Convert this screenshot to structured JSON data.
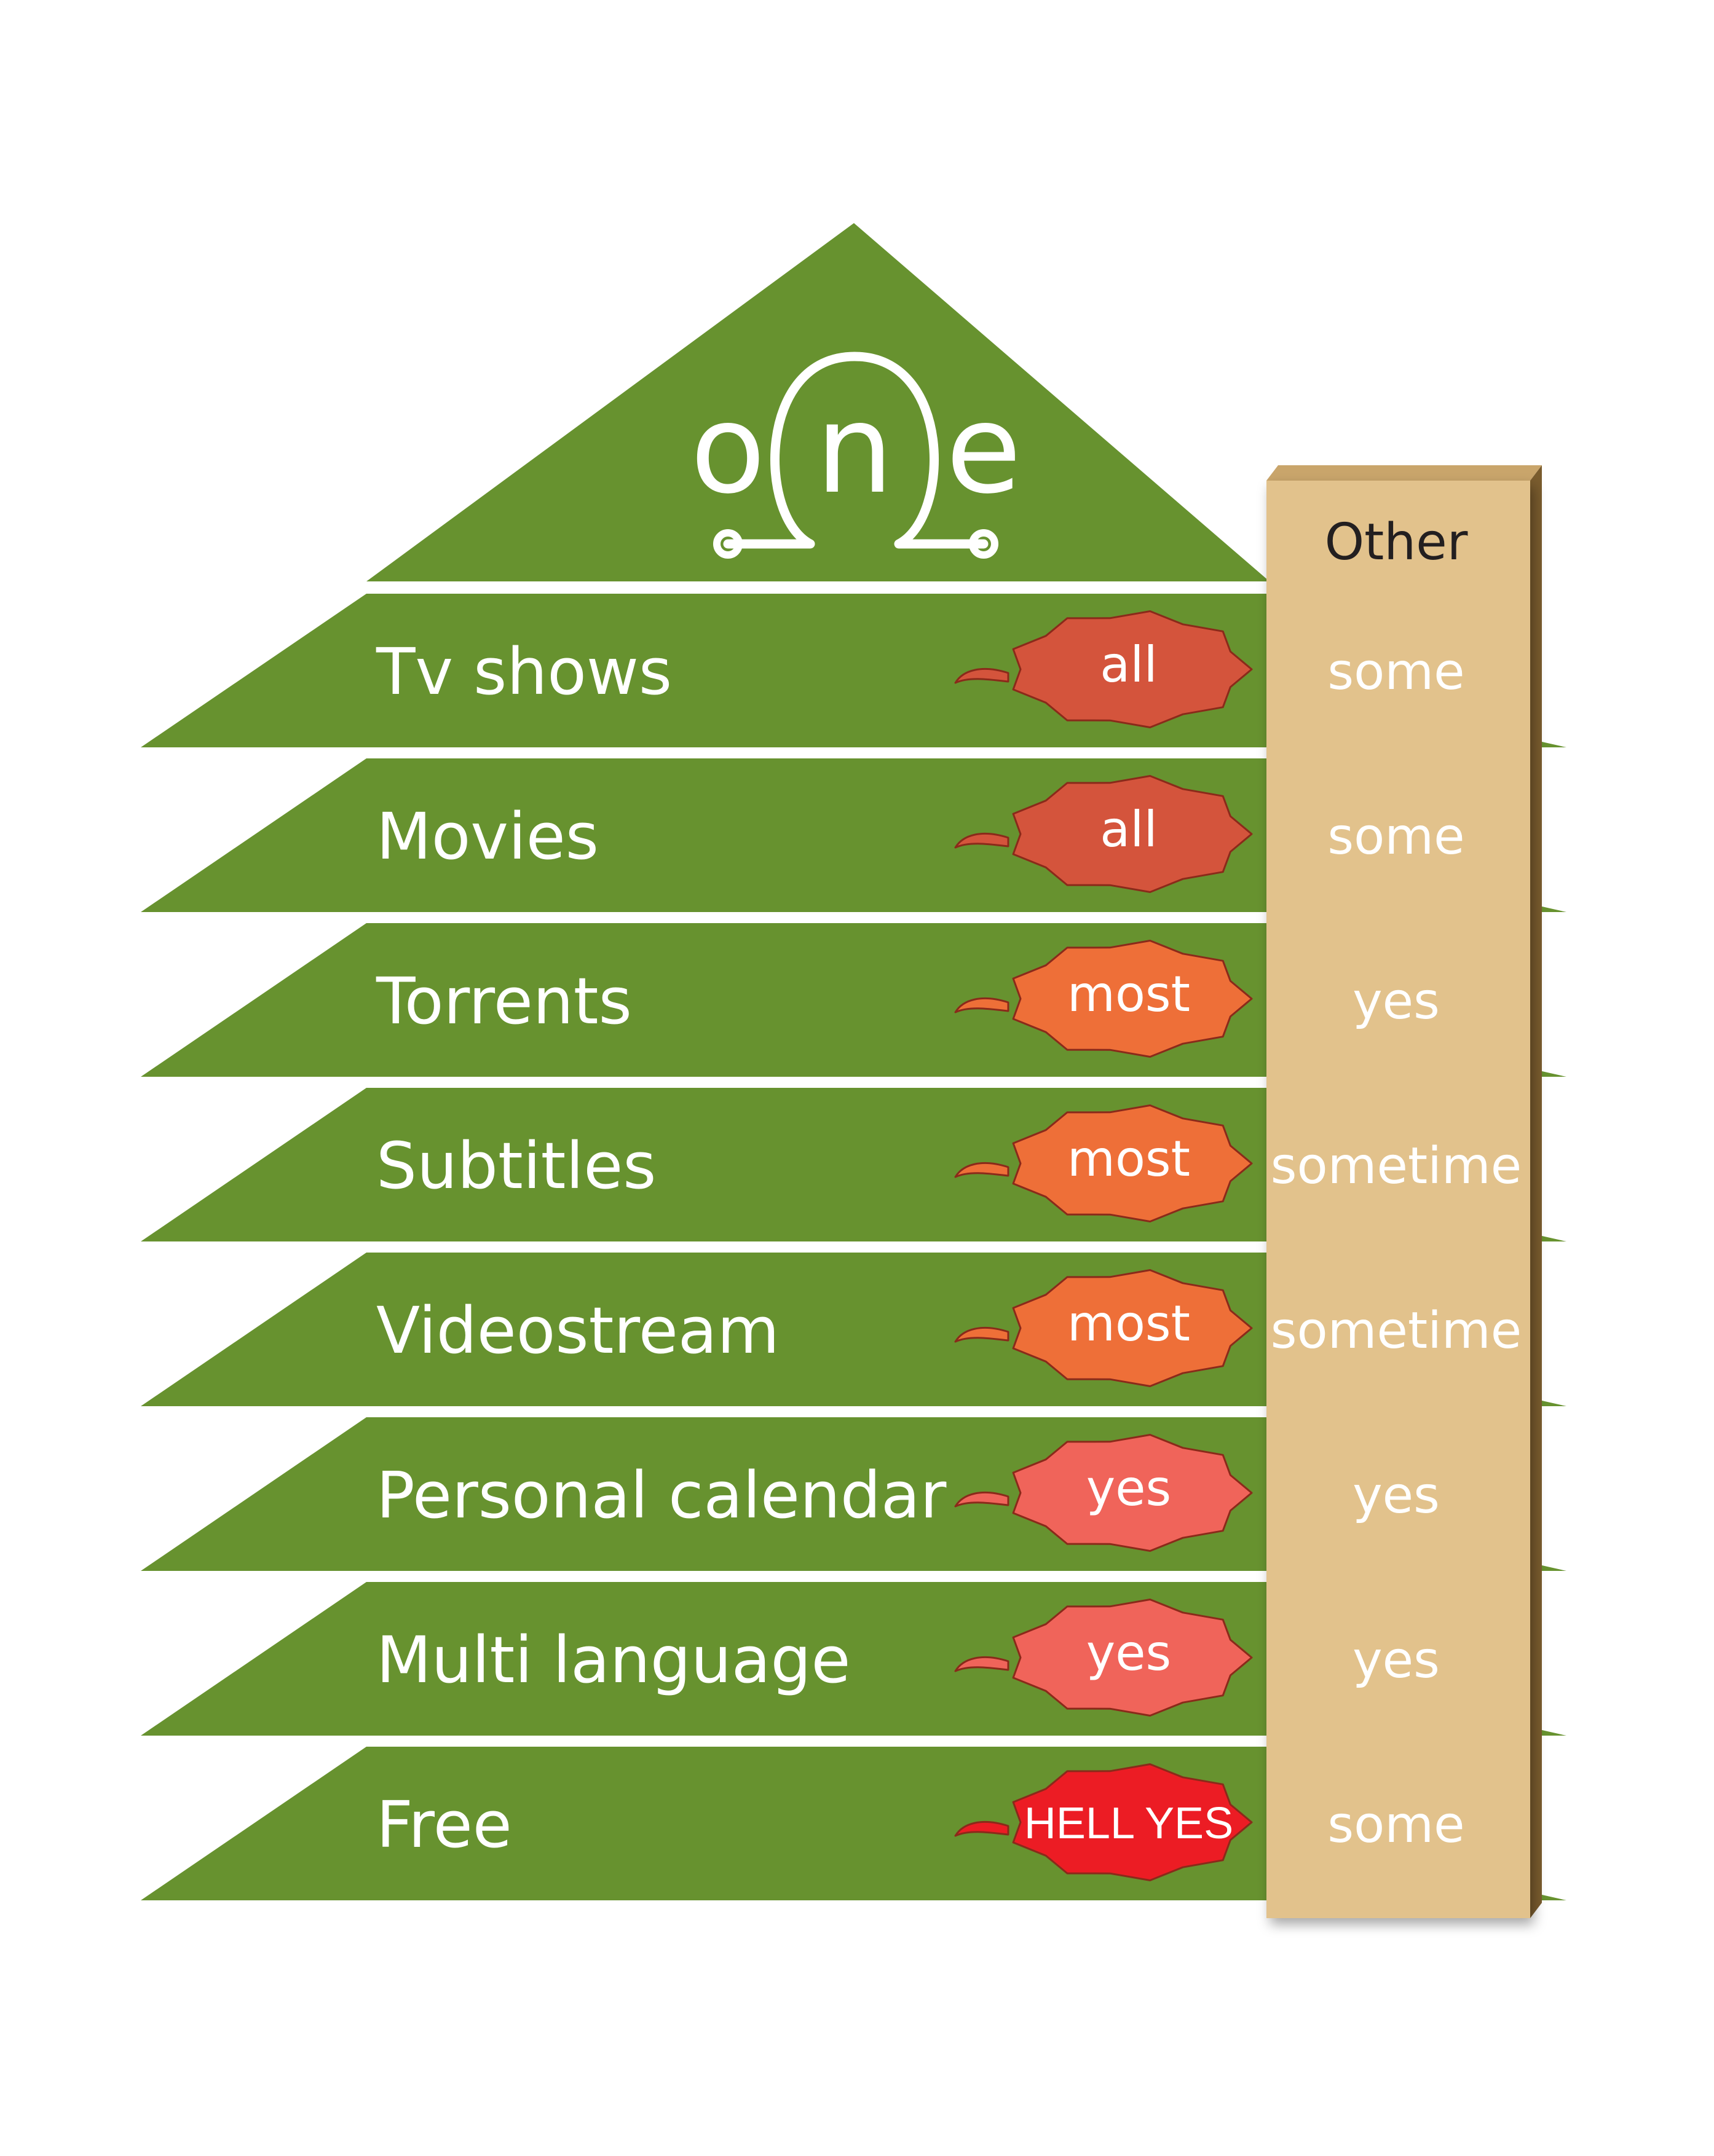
{
  "logo": {
    "letters": [
      "o",
      "n",
      "e"
    ]
  },
  "comparison_header": "Other",
  "rows": [
    {
      "feature": "Tv shows",
      "one": "all",
      "other": "some",
      "badge_color": "#d4543c"
    },
    {
      "feature": "Movies",
      "one": "all",
      "other": "some",
      "badge_color": "#d4543c"
    },
    {
      "feature": "Torrents",
      "one": "most",
      "other": "yes",
      "badge_color": "#ee6f38"
    },
    {
      "feature": "Subtitles",
      "one": "most",
      "other": "sometime",
      "badge_color": "#ee6f38"
    },
    {
      "feature": "Videostream",
      "one": "most",
      "other": "sometime",
      "badge_color": "#ee6f38"
    },
    {
      "feature": "Personal calendar",
      "one": "yes",
      "other": "yes",
      "badge_color": "#f0645a"
    },
    {
      "feature": "Multi language",
      "one": "yes",
      "other": "yes",
      "badge_color": "#f0645a"
    },
    {
      "feature": "Free",
      "one": "HELL YES",
      "other": "some",
      "badge_color": "#ec1c24"
    }
  ],
  "colors": {
    "green": "#67922f",
    "column_face": "#e2c28c",
    "column_side": "#7a5c2e",
    "column_top": "#c9a56b",
    "header_text": "#231f20",
    "white": "#ffffff"
  }
}
